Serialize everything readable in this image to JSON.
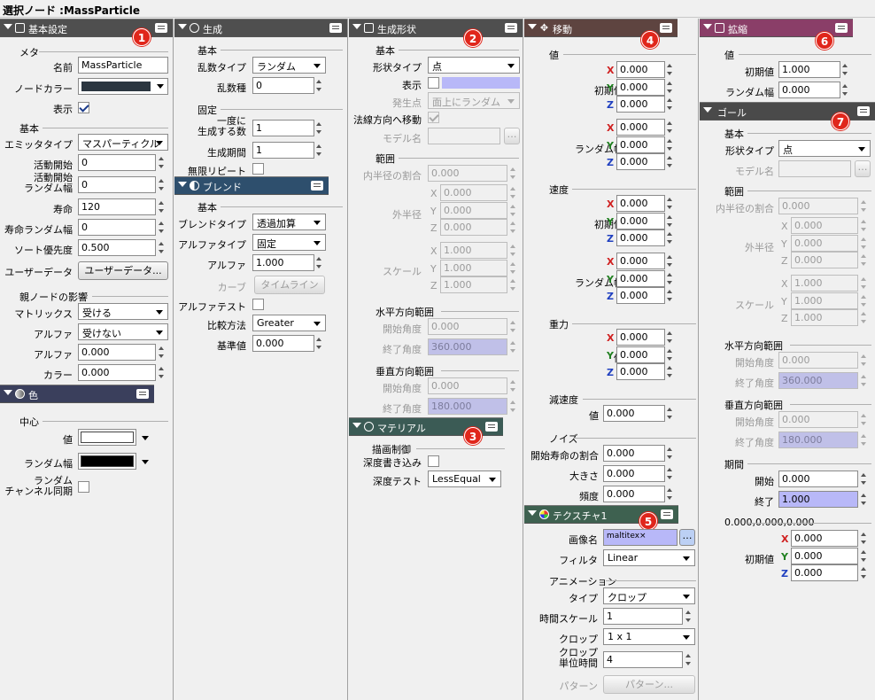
{
  "title": "選択ノード :MassParticle",
  "colors": {
    "basic": "#4f4f4f",
    "blend": "#2e4f6d",
    "color": "#3a3f5c",
    "material": "#3b5b55",
    "move": "#5e4440",
    "texture": "#3e6150",
    "scale": "#8a3e68",
    "goal": "#4a4a4a",
    "highlight": "#b8b8f8",
    "badge": "#e0261b"
  },
  "icons": [
    "collapse-triangle",
    "comment-icon",
    "gear-icon",
    "shape-icon",
    "move-arrows-icon",
    "scale-icon",
    "blend-icon",
    "color-wheel-icon",
    "material-icon",
    "texture-icon",
    "spin-button",
    "dropdown-arrow"
  ],
  "badges": [
    "1",
    "2",
    "3",
    "4",
    "5",
    "6",
    "7"
  ],
  "axes": [
    "X",
    "Y",
    "Z"
  ],
  "col1": {
    "header": "基本設定",
    "meta": "メタ",
    "name_label": "名前",
    "name_value": "MassParticle",
    "node_color_label": "ノードカラー",
    "visible_label": "表示",
    "basic": "基本",
    "emitter_label": "エミッタタイプ",
    "emitter_value": "マスパーティクル",
    "start_label": "活動開始",
    "start_value": "0",
    "start_rand_label1": "活動開始",
    "start_rand_label2": "ランダム幅",
    "start_rand_value": "0",
    "life_label": "寿命",
    "life_value": "120",
    "life_rand_label": "寿命ランダム幅",
    "life_rand_value": "0",
    "sort_label": "ソート優先度",
    "sort_value": "0.500",
    "user_label": "ユーザーデータ",
    "user_button": "ユーザーデータ...",
    "parent": "親ノードの影響",
    "matrix_label": "マトリックス",
    "matrix_value": "受ける",
    "alpha_label": "アルファ",
    "alpha_value": "受けない",
    "alpha2_label": "アルファ",
    "alpha2_value": "0.000",
    "color_label": "カラー",
    "color_value": "0.000",
    "color_header": "色",
    "center": "中心",
    "c_value_label": "値",
    "c_rand_label": "ランダム幅",
    "c_sync_label1": "ランダム",
    "c_sync_label2": "チャンネル同期"
  },
  "col2": {
    "header": "生成",
    "basic": "基本",
    "rand_type_label": "乱数タイプ",
    "rand_type_value": "ランダム",
    "seed_label": "乱数種",
    "seed_value": "0",
    "fixed": "固定",
    "once_label1": "一度に",
    "once_label2": "生成する数",
    "once_value": "1",
    "period_label": "生成期間",
    "period_value": "1",
    "repeat_label": "無限リピート",
    "blend_header": "ブレンド",
    "b_basic": "基本",
    "blend_type_label": "ブレンドタイプ",
    "blend_type_value": "透過加算",
    "alpha_type_label": "アルファタイプ",
    "alpha_type_value": "固定",
    "alpha_label": "アルファ",
    "alpha_value": "1.000",
    "curve_label": "カーブ",
    "curve_button": "タイムライン",
    "alpha_test_label": "アルファテスト",
    "compare_label": "比較方法",
    "compare_value": "Greater",
    "ref_label": "基準値",
    "ref_value": "0.000"
  },
  "col3": {
    "header": "生成形状",
    "basic": "基本",
    "shape_label": "形状タイプ",
    "shape_value": "点",
    "visible_label": "表示",
    "gen_point_label": "発生点",
    "gen_point_value": "面上にランダム",
    "normal_label": "法線方向へ移動",
    "model_label": "モデル名",
    "range": "範囲",
    "inner_label": "内半径の割合",
    "inner_value": "0.000",
    "outer_label": "外半径",
    "outer_x": "0.000",
    "outer_y": "0.000",
    "outer_z": "0.000",
    "scale_label": "スケール",
    "scale_x": "1.000",
    "scale_y": "1.000",
    "scale_z": "1.000",
    "h_range": "水平方向範囲",
    "h_start_label": "開始角度",
    "h_start_value": "0.000",
    "h_end_label": "終了角度",
    "h_end_value": "360.000",
    "v_range": "垂直方向範囲",
    "v_start_label": "開始角度",
    "v_start_value": "0.000",
    "v_end_label": "終了角度",
    "v_end_value": "180.000",
    "material_header": "マテリアル",
    "draw": "描画制御",
    "depth_write_label": "深度書き込み",
    "depth_test_label": "深度テスト",
    "depth_test_value": "LessEqual"
  },
  "col4": {
    "header": "移動",
    "value": "値",
    "init_label": "初期値",
    "init": [
      "0.000",
      "0.000",
      "0.000"
    ],
    "rand_label": "ランダム幅",
    "rand": [
      "0.000",
      "0.000",
      "0.000"
    ],
    "speed": "速度",
    "s_init_label": "初期値",
    "s_init": [
      "0.000",
      "0.000",
      "0.000"
    ],
    "s_rand_label": "ランダム幅",
    "s_rand": [
      "0.000",
      "0.000",
      "0.000"
    ],
    "gravity": "重力",
    "g_label": "値",
    "g": [
      "0.000",
      "0.000",
      "0.000"
    ],
    "decel": "減速度",
    "d_label": "値",
    "d_value": "0.000",
    "noise": "ノイズ",
    "n_start_label": "開始寿命の割合",
    "n_start_value": "0.000",
    "n_size_label": "大きさ",
    "n_size_value": "0.000",
    "n_freq_label": "頻度",
    "n_freq_value": "0.000",
    "tex_header": "テクスチャ1",
    "img_label": "画像名",
    "img_value": "maltitex",
    "filter_label": "フィルタ",
    "filter_value": "Linear",
    "anim": "アニメーション",
    "type_label": "タイプ",
    "type_value": "クロップ",
    "tscale_label": "時間スケール",
    "tscale_value": "1",
    "crop_label": "クロップ",
    "crop_value": "1 x 1",
    "cropu_label1": "クロップ",
    "cropu_label2": "単位時間",
    "cropu_value": "4",
    "pattern_label": "パターン",
    "pattern_button": "パターン..."
  },
  "col5": {
    "header": "拡縮",
    "value": "値",
    "init_label": "初期値",
    "init_value": "1.000",
    "rand_label": "ランダム幅",
    "rand_value": "0.000",
    "goal_header": "ゴール",
    "g_basic": "基本",
    "shape_label": "形状タイプ",
    "shape_value": "点",
    "model_label": "モデル名",
    "range": "範囲",
    "inner_label": "内半径の割合",
    "inner_value": "0.000",
    "outer_label": "外半径",
    "outer_x": "0.000",
    "outer_y": "0.000",
    "outer_z": "0.000",
    "scale_label": "スケール",
    "scale_x": "1.000",
    "scale_y": "1.000",
    "scale_z": "1.000",
    "h_range": "水平方向範囲",
    "h_start_label": "開始角度",
    "h_start_value": "0.000",
    "h_end_label": "終了角度",
    "h_end_value": "360.000",
    "v_range": "垂直方向範囲",
    "v_start_label": "開始角度",
    "v_start_value": "0.000",
    "v_end_label": "終了角度",
    "v_end_value": "180.000",
    "period": "期間",
    "p_start_label": "開始",
    "p_start_value": "0.000",
    "p_end_label": "終了",
    "p_end_value": "1.000",
    "pos": [
      "0.000",
      "0.000",
      "0.000"
    ],
    "pos_label": "初期値"
  }
}
